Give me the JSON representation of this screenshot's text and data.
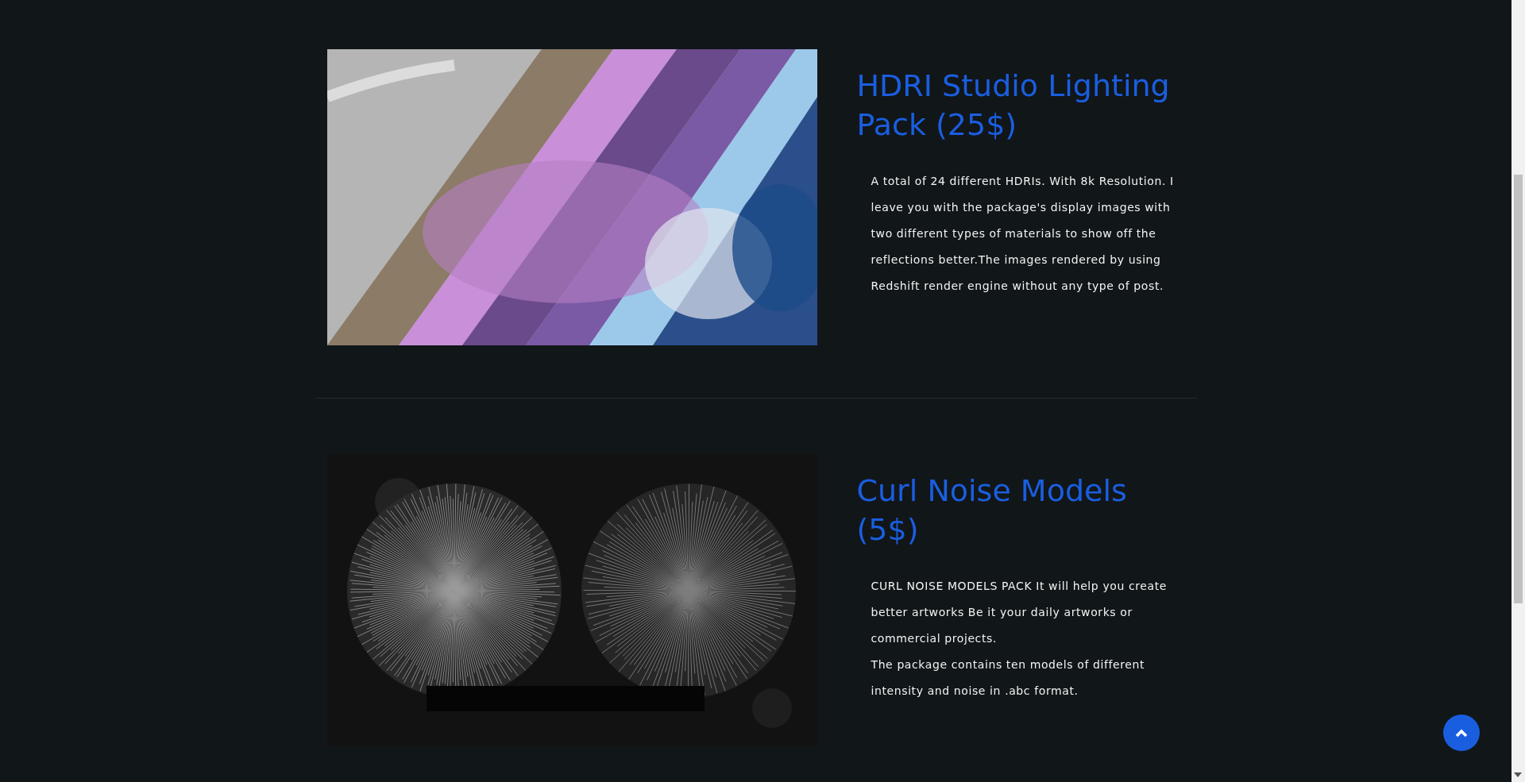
{
  "products": [
    {
      "kind": "hdri",
      "title": "HDRI Studio Lighting Pack (25$)",
      "paragraphs": [
        "A total of 24 different HDRIs. With 8k Resolution. I leave you with the package's display images with two different types of materials to show off the reflections better.The images rendered by using Redshift render engine without any type of post."
      ]
    },
    {
      "kind": "curl",
      "title": "Curl Noise Models (5$)",
      "paragraphs": [
        "CURL NOISE MODELS PACK It will help you create better artworks Be it your daily artworks or commercial projects.",
        "The package contains ten models of different intensity and noise in .abc format."
      ]
    }
  ]
}
